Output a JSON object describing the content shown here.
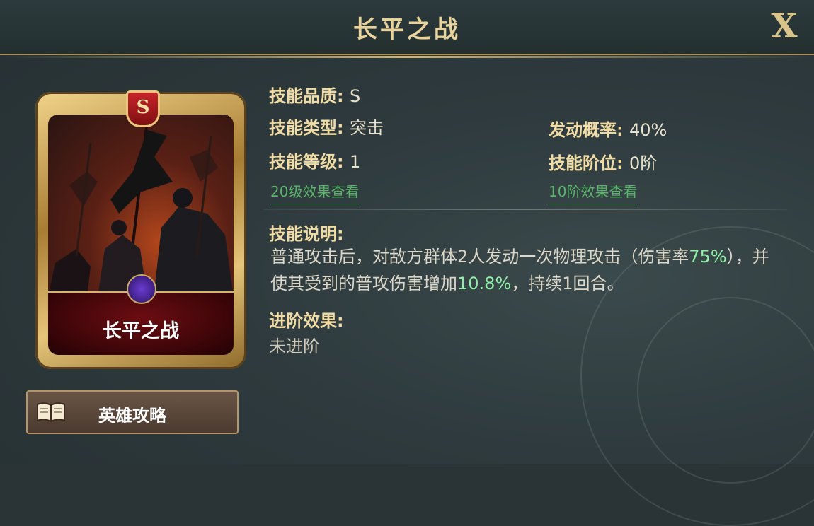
{
  "dialog": {
    "title": "长平之战",
    "close_label": "X"
  },
  "card": {
    "grade": "S",
    "name": "长平之战"
  },
  "guide_button": {
    "label": "英雄攻略",
    "icon": "book-icon"
  },
  "attributes": {
    "quality_label": "技能品质:",
    "quality_value": "S",
    "type_label": "技能类型:",
    "type_value": "突击",
    "level_label": "技能等级:",
    "level_value": "1",
    "rate_label": "发动概率:",
    "rate_value": "40%",
    "rank_label": "技能阶位:",
    "rank_value": "0阶",
    "level_link": "20级效果查看",
    "rank_link": "10阶效果查看"
  },
  "description": {
    "heading": "技能说明:",
    "part1": "普通攻击后，对敌方群体2人发动一次物理攻击（伤害率",
    "damage_rate": "75%",
    "part2": "），并使其受到的普攻伤害增加",
    "increase": "10.8%",
    "part3": "，持续1回合。"
  },
  "advancement": {
    "heading": "进阶效果:",
    "value": "未进阶"
  },
  "colors": {
    "highlight": "#8ff0a6",
    "link": "#5ab56a",
    "gold": "#e8d39b"
  }
}
